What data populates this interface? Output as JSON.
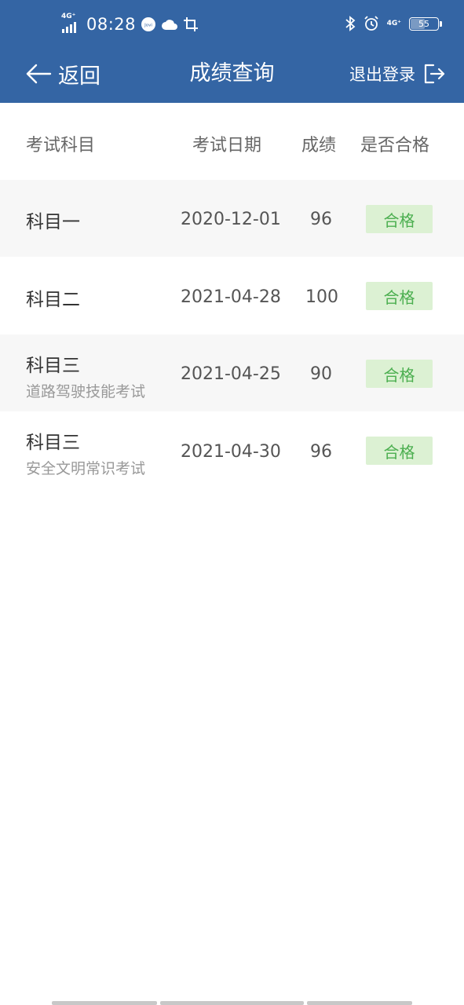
{
  "status_bar": {
    "network_left": "4G⁺",
    "time": "08:28",
    "jovi_label": "Jovi",
    "network_right": "4G⁺",
    "battery": "55",
    "battery_level": 0.55
  },
  "nav": {
    "back_label": "返回",
    "title": "成绩查询",
    "logout_label": "退出登录"
  },
  "table": {
    "headers": {
      "subject": "考试科目",
      "date": "考试日期",
      "score": "成绩",
      "passed": "是否合格"
    },
    "rows": [
      {
        "subject": "科目一",
        "subtitle": "",
        "date": "2020-12-01",
        "score": "96",
        "status": "合格"
      },
      {
        "subject": "科目二",
        "subtitle": "",
        "date": "2021-04-28",
        "score": "100",
        "status": "合格"
      },
      {
        "subject": "科目三",
        "subtitle": "道路驾驶技能考试",
        "date": "2021-04-25",
        "score": "90",
        "status": "合格"
      },
      {
        "subject": "科目三",
        "subtitle": "安全文明常识考试",
        "date": "2021-04-30",
        "score": "96",
        "status": "合格"
      }
    ]
  },
  "colors": {
    "header_bg": "#3465a4",
    "badge_bg": "#dcf1d3",
    "badge_text": "#4caf50",
    "row_alt_bg": "#f7f7f7"
  }
}
